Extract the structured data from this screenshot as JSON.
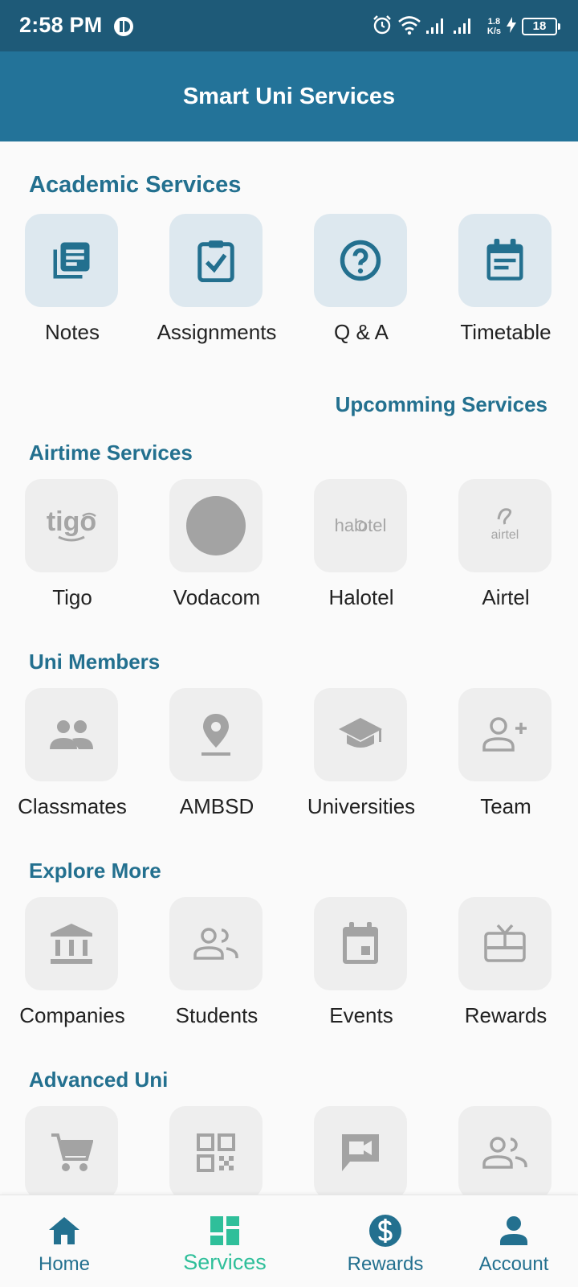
{
  "status_bar": {
    "time": "2:58 PM",
    "net_speed_value": "1.8",
    "net_speed_unit": "K/s",
    "battery": "18"
  },
  "app_bar": {
    "title": "Smart Uni Services"
  },
  "academic": {
    "title": "Academic Services",
    "items": [
      {
        "label": "Notes",
        "icon": "notes-icon"
      },
      {
        "label": "Assignments",
        "icon": "clipboard-check-icon"
      },
      {
        "label": "Q & A",
        "icon": "help-circle-icon"
      },
      {
        "label": "Timetable",
        "icon": "calendar-icon"
      }
    ],
    "upcoming_label": "Upcomming Services"
  },
  "airtime": {
    "title": "Airtime Services",
    "items": [
      {
        "label": "Tigo",
        "logo_text": "tigo"
      },
      {
        "label": "Vodacom"
      },
      {
        "label": "Halotel",
        "logo_text": "halotel"
      },
      {
        "label": "Airtel",
        "logo_text": "airtel"
      }
    ]
  },
  "members": {
    "title": "Uni Members",
    "items": [
      {
        "label": "Classmates",
        "icon": "people-icon"
      },
      {
        "label": "AMBSD",
        "icon": "location-pin-icon"
      },
      {
        "label": "Universities",
        "icon": "graduation-cap-icon"
      },
      {
        "label": "Team",
        "icon": "add-person-icon"
      }
    ]
  },
  "explore": {
    "title": "Explore More",
    "items": [
      {
        "label": "Companies",
        "icon": "bank-icon"
      },
      {
        "label": "Students",
        "icon": "people-outline-icon"
      },
      {
        "label": "Events",
        "icon": "event-icon"
      },
      {
        "label": "Rewards",
        "icon": "gift-card-icon"
      }
    ]
  },
  "advanced": {
    "title": "Advanced Uni",
    "items": [
      {
        "icon": "cart-icon"
      },
      {
        "icon": "qr-code-icon"
      },
      {
        "icon": "video-chat-icon"
      },
      {
        "icon": "people-outline-icon"
      }
    ]
  },
  "bottom_nav": {
    "items": [
      {
        "label": "Home",
        "icon": "home-icon"
      },
      {
        "label": "Services",
        "icon": "dashboard-icon",
        "active": true
      },
      {
        "label": "Rewards",
        "icon": "dollar-circle-icon"
      },
      {
        "label": "Account",
        "icon": "person-icon"
      }
    ]
  },
  "colors": {
    "status_bar": "#1e5a78",
    "app_bar": "#237399",
    "accent": "#23708f",
    "active_nav": "#2fbf9a",
    "tile_bg": "#eeeeee",
    "academic_tile_bg": "#dde8ef",
    "inactive_icon": "#a3a3a3"
  }
}
